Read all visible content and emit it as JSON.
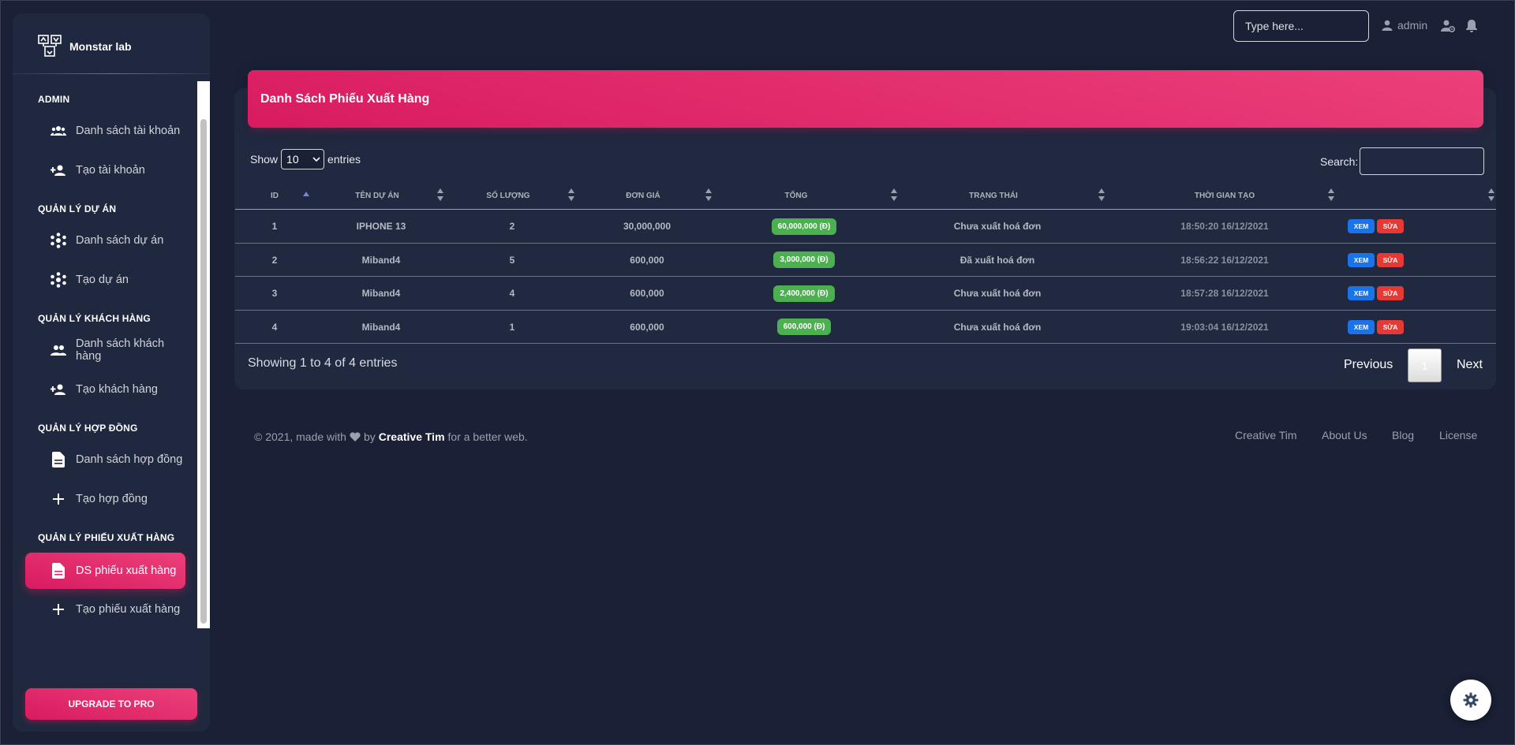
{
  "brand": {
    "name": "Monstar lab"
  },
  "sidebar": {
    "sections": [
      {
        "title": "ADMIN"
      },
      {
        "title": "QUẢN LÝ DỰ ÁN"
      },
      {
        "title": "QUẢN LÝ KHÁCH HÀNG"
      },
      {
        "title": "QUẢN LÝ HỢP ĐỒNG"
      },
      {
        "title": "QUẢN LÝ PHIẾU XUẤT HÀNG"
      }
    ],
    "items": [
      {
        "label": "Danh sách tài khoản",
        "icon": "group-icon"
      },
      {
        "label": "Tạo tài khoản",
        "icon": "person-add-icon"
      },
      {
        "label": "Danh sách dự án",
        "icon": "workspaces-icon"
      },
      {
        "label": "Tạo dự án",
        "icon": "workspaces-icon"
      },
      {
        "label": "Danh sách khách hàng",
        "icon": "people-icon"
      },
      {
        "label": "Tạo khách hàng",
        "icon": "person-add-icon"
      },
      {
        "label": "Danh sách hợp đồng",
        "icon": "document-icon"
      },
      {
        "label": "Tạo hợp đồng",
        "icon": "plus-icon"
      },
      {
        "label": "DS phiếu xuất hàng",
        "icon": "document-icon",
        "active": true
      },
      {
        "label": "Tạo phiếu xuất hàng",
        "icon": "plus-icon"
      }
    ],
    "upgrade_label": "UPGRADE TO PRO"
  },
  "topnav": {
    "search_placeholder": "Type here...",
    "user_label": "admin"
  },
  "card": {
    "title": "Danh Sách Phiếu Xuất Hàng"
  },
  "table_controls": {
    "show_label": "Show",
    "length_value": "10",
    "entries_label": "entries",
    "search_label": "Search:"
  },
  "table": {
    "columns": [
      "ID",
      "TÊN DỰ ÁN",
      "SỐ LƯỢNG",
      "ĐƠN GIÁ",
      "TỔNG",
      "TRẠNG THÁI",
      "THỜI GIAN TẠO",
      ""
    ],
    "rows": [
      {
        "id": "1",
        "project": "IPHONE 13",
        "qty": "2",
        "price": "30,000,000",
        "total": "60,000,000 (Đ)",
        "status": "Chưa xuất hoá đơn",
        "created": "18:50:20 16/12/2021",
        "view": "XEM",
        "edit": "SỬA"
      },
      {
        "id": "2",
        "project": "Miband4",
        "qty": "5",
        "price": "600,000",
        "total": "3,000,000 (Đ)",
        "status": "Đã xuất hoá đơn",
        "created": "18:56:22 16/12/2021",
        "view": "XEM",
        "edit": "SỬA"
      },
      {
        "id": "3",
        "project": "Miband4",
        "qty": "4",
        "price": "600,000",
        "total": "2,400,000 (Đ)",
        "status": "Chưa xuất hoá đơn",
        "created": "18:57:28 16/12/2021",
        "view": "XEM",
        "edit": "SỬA"
      },
      {
        "id": "4",
        "project": "Miband4",
        "qty": "1",
        "price": "600,000",
        "total": "600,000 (Đ)",
        "status": "Chưa xuất hoá đơn",
        "created": "19:03:04 16/12/2021",
        "view": "XEM",
        "edit": "SỬA"
      }
    ]
  },
  "pagination": {
    "info": "Showing 1 to 4 of 4 entries",
    "previous": "Previous",
    "current": "1",
    "next": "Next"
  },
  "footer": {
    "copyright": "© 2021, made with",
    "by": "by",
    "author": "Creative Tim",
    "suffix": "for a better web.",
    "links": [
      "Creative Tim",
      "About Us",
      "Blog",
      "License"
    ]
  }
}
